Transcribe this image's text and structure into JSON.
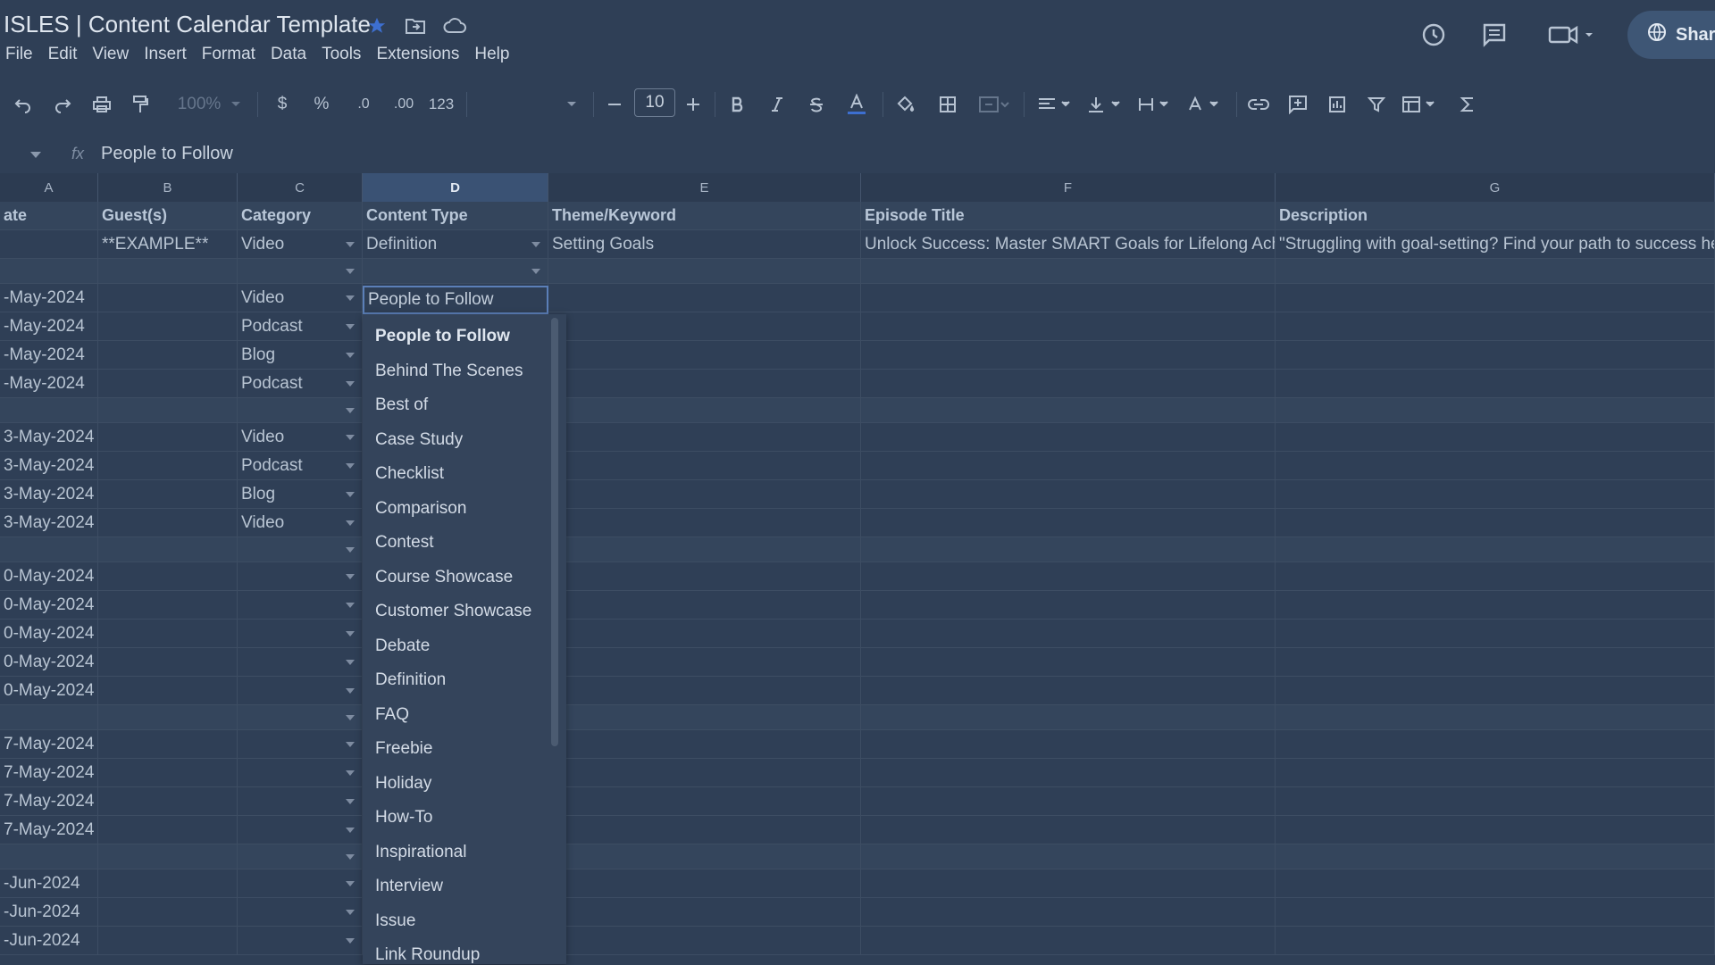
{
  "title_bar": {
    "doc_title": "ISLES | Content Calendar Template",
    "icons": [
      "star-icon",
      "move-folder-icon",
      "cloud-status-icon"
    ],
    "share_label": "Shar"
  },
  "menu": [
    "File",
    "Edit",
    "View",
    "Insert",
    "Format",
    "Data",
    "Tools",
    "Extensions",
    "Help"
  ],
  "toolbar": {
    "zoom": "100%",
    "currency": "$",
    "percent": "%",
    "decimal_decrease": ".0",
    "decimal_increase": ".00",
    "number_format": "123",
    "font_size": "10"
  },
  "formula_bar": {
    "fx": "fx",
    "value": "People to Follow"
  },
  "columns": [
    {
      "letter": "A"
    },
    {
      "letter": "B"
    },
    {
      "letter": "C"
    },
    {
      "letter": "D",
      "selected": true
    },
    {
      "letter": "E"
    },
    {
      "letter": "F"
    },
    {
      "letter": "G"
    }
  ],
  "header_row": {
    "a": "ate",
    "b": "Guest(s)",
    "c": "Category",
    "d": "Content Type",
    "e": "Theme/Keyword",
    "f": "Episode Title",
    "g": "Description"
  },
  "example_row": {
    "b": "**EXAMPLE**",
    "c": "Video",
    "d": "Definition",
    "e": "Setting Goals",
    "f": "Unlock Success: Master SMART Goals for Lifelong Achie",
    "g": "\"Struggling with goal-setting? Find your path to success here"
  },
  "rows": [
    {
      "date": "",
      "category": "",
      "sep": true
    },
    {
      "date": "-May-2024",
      "category": "Video"
    },
    {
      "date": "-May-2024",
      "category": "Podcast"
    },
    {
      "date": "-May-2024",
      "category": "Blog"
    },
    {
      "date": "-May-2024",
      "category": "Podcast"
    },
    {
      "date": "",
      "category": "",
      "sep": true
    },
    {
      "date": "3-May-2024",
      "category": "Video"
    },
    {
      "date": "3-May-2024",
      "category": "Podcast"
    },
    {
      "date": "3-May-2024",
      "category": "Blog"
    },
    {
      "date": "3-May-2024",
      "category": "Video"
    },
    {
      "date": "",
      "category": "",
      "sep": true
    },
    {
      "date": "0-May-2024",
      "category": ""
    },
    {
      "date": "0-May-2024",
      "category": ""
    },
    {
      "date": "0-May-2024",
      "category": ""
    },
    {
      "date": "0-May-2024",
      "category": ""
    },
    {
      "date": "0-May-2024",
      "category": ""
    },
    {
      "date": "",
      "category": "",
      "sep": true
    },
    {
      "date": "7-May-2024",
      "category": ""
    },
    {
      "date": "7-May-2024",
      "category": ""
    },
    {
      "date": "7-May-2024",
      "category": ""
    },
    {
      "date": "7-May-2024",
      "category": ""
    },
    {
      "date": "",
      "category": "",
      "sep": true
    },
    {
      "date": "-Jun-2024",
      "category": ""
    },
    {
      "date": "-Jun-2024",
      "category": ""
    },
    {
      "date": "-Jun-2024",
      "category": ""
    }
  ],
  "selected_cell": "People to Follow",
  "dropdown_options": [
    "People to Follow",
    "Behind The Scenes",
    "Best of",
    "Case Study",
    "Checklist",
    "Comparison",
    "Contest",
    "Course Showcase",
    "Customer Showcase",
    "Debate",
    "Definition",
    "FAQ",
    "Freebie",
    "Holiday",
    "How-To",
    "Inspirational",
    "Interview",
    "Issue",
    "Link Roundup"
  ]
}
